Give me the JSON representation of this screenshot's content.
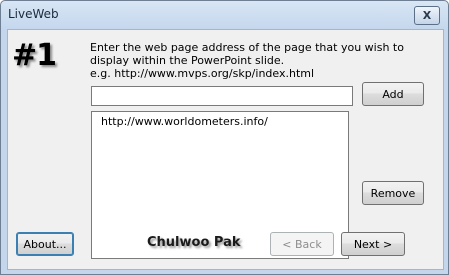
{
  "window": {
    "title": "LiveWeb",
    "close_glyph": "X"
  },
  "step_number": "#1",
  "instructions": {
    "line1": "Enter the web page address of the page that you wish to",
    "line2": "display within the PowerPoint slide.",
    "line3": "e.g. http://www.mvps.org/skp/index.html"
  },
  "url_input": {
    "value": "",
    "placeholder": ""
  },
  "url_list": {
    "items": [
      "http://www.worldometers.info/"
    ]
  },
  "buttons": {
    "add": "Add",
    "remove": "Remove",
    "about": "About...",
    "back": "< Back",
    "next": "Next >"
  },
  "author": "Chulwoo Pak"
}
